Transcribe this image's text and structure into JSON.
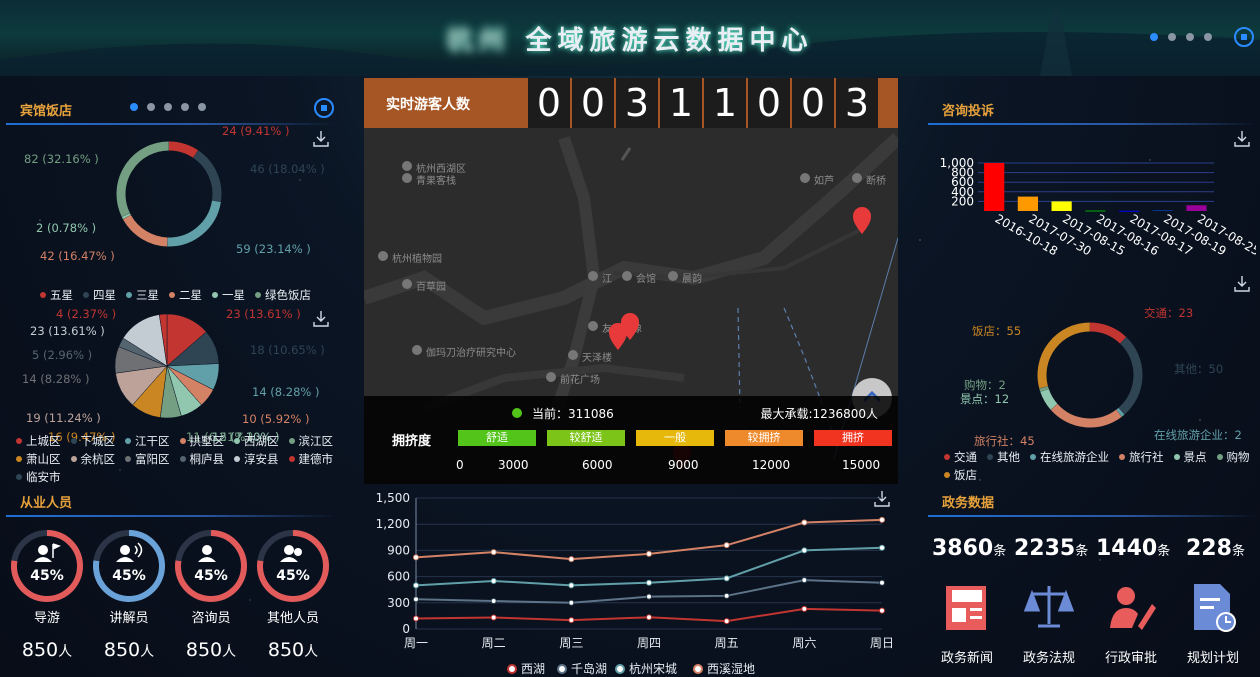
{
  "header": {
    "title_blurred": "杭州",
    "title": "全域旅游云数据中心",
    "dots": 4,
    "active_dot": 0
  },
  "hotel": {
    "title": "宾馆饭店",
    "star_ring": [
      {
        "label": "24 (9.41% )",
        "value": 24,
        "color": "#c23531"
      },
      {
        "label": "46 (18.04% )",
        "value": 46,
        "color": "#2f4554"
      },
      {
        "label": "59 (23.14% )",
        "value": 59,
        "color": "#61a0a8"
      },
      {
        "label": "42 (16.47% )",
        "value": 42,
        "color": "#d48265"
      },
      {
        "label": "2 (0.78% )",
        "value": 2,
        "color": "#91c7ae"
      },
      {
        "label": "82 (32.16% )",
        "value": 82,
        "color": "#749f83"
      }
    ],
    "star_legend": [
      {
        "name": "五星",
        "color": "#c23531"
      },
      {
        "name": "四星",
        "color": "#2f4554"
      },
      {
        "name": "三星",
        "color": "#61a0a8"
      },
      {
        "name": "二星",
        "color": "#d48265"
      },
      {
        "name": "一星",
        "color": "#91c7ae"
      },
      {
        "name": "绿色饭店",
        "color": "#749f83"
      }
    ],
    "district_pie": [
      {
        "label": "23 (13.61% )",
        "value": 23,
        "color": "#c23531"
      },
      {
        "label": "18 (10.65% )",
        "value": 18,
        "color": "#2f4554"
      },
      {
        "label": "14 (8.28% )",
        "value": 14,
        "color": "#61a0a8"
      },
      {
        "label": "10 (5.92% )",
        "value": 10,
        "color": "#d48265"
      },
      {
        "label": "12 (7.10% )",
        "value": 12,
        "color": "#91c7ae"
      },
      {
        "label": "11 (6.51% )",
        "value": 11,
        "color": "#749f83"
      },
      {
        "label": "16 (9.47% )",
        "value": 16,
        "color": "#ca8622"
      },
      {
        "label": "19 (11.24% )",
        "value": 19,
        "color": "#bda29a"
      },
      {
        "label": "14 (8.28% )",
        "value": 14,
        "color": "#6e7074"
      },
      {
        "label": "5 (2.96% )",
        "value": 5,
        "color": "#546570"
      },
      {
        "label": "23 (13.61% )",
        "value": 23,
        "color": "#c4ccd3"
      },
      {
        "label": "4 (2.37% )",
        "value": 4,
        "color": "#c23531"
      }
    ],
    "district_legend": [
      {
        "name": "上城区",
        "color": "#c23531"
      },
      {
        "name": "下城区",
        "color": "#2f4554"
      },
      {
        "name": "江干区",
        "color": "#61a0a8"
      },
      {
        "name": "拱墅区",
        "color": "#d48265"
      },
      {
        "name": "西湖区",
        "color": "#91c7ae"
      },
      {
        "name": "滨江区",
        "color": "#749f83"
      },
      {
        "name": "萧山区",
        "color": "#ca8622"
      },
      {
        "name": "余杭区",
        "color": "#bda29a"
      },
      {
        "name": "富阳区",
        "color": "#6e7074"
      },
      {
        "name": "桐庐县",
        "color": "#546570"
      },
      {
        "name": "淳安县",
        "color": "#c4ccd3"
      },
      {
        "name": "建德市",
        "color": "#c23531"
      },
      {
        "name": "临安市",
        "color": "#2f4554"
      }
    ]
  },
  "visitors": {
    "label": "实时游客人数",
    "digits": [
      "0",
      "0",
      "3",
      "1",
      "1",
      "0",
      "0",
      "3"
    ],
    "current": "当前：311086",
    "max": "最大承载:1236800人",
    "crowd_label": "拥挤度",
    "levels": [
      {
        "name": "舒适",
        "color": "#52c41a"
      },
      {
        "name": "较舒适",
        "color": "#7cc417"
      },
      {
        "name": "一般",
        "color": "#e5b80b"
      },
      {
        "name": "较拥挤",
        "color": "#ef8a2c"
      },
      {
        "name": "拥挤",
        "color": "#f0341f"
      }
    ],
    "scale": [
      "0",
      "3000",
      "6000",
      "9000",
      "12000",
      "15000"
    ],
    "map_places": [
      "杭州西湖区",
      "青果客栈",
      "杭州植物园",
      "百草园",
      "伽玛刀治疗研究中心",
      "友爱之像",
      "天泽楼",
      "前花广场",
      "会馆",
      "晨韵",
      "如芦",
      "断桥",
      "江"
    ]
  },
  "consult": {
    "title": "咨询投诉",
    "chart_data": {
      "type": "bar",
      "categories": [
        "2016-10-18",
        "2017-07-30",
        "2017-08-15",
        "2017-08-16",
        "2017-08-17",
        "2017-08-19",
        "2017-08-25"
      ],
      "values": [
        1000,
        300,
        200,
        10,
        5,
        20,
        120
      ],
      "colors": [
        "#ff0000",
        "#ff9900",
        "#ffff00",
        "#00aa00",
        "#0000ff",
        "#003399",
        "#990099"
      ],
      "yticks": [
        "1,000",
        "800",
        "600",
        "400",
        "200"
      ],
      "ylim": [
        0,
        1000
      ]
    },
    "ring": [
      {
        "name": "交通",
        "value": 23,
        "color": "#c23531",
        "label": "交通：23"
      },
      {
        "name": "其他",
        "value": 50,
        "color": "#2f4554",
        "label": "其他：50"
      },
      {
        "name": "在线旅游企业",
        "value": 2,
        "color": "#61a0a8",
        "label": "在线旅游企业：2"
      },
      {
        "name": "旅行社",
        "value": 45,
        "color": "#d48265",
        "label": "旅行社：45"
      },
      {
        "name": "景点",
        "value": 12,
        "color": "#91c7ae",
        "label": "景点：12"
      },
      {
        "name": "购物",
        "value": 2,
        "color": "#749f83",
        "label": "购物：2"
      },
      {
        "name": "饭店",
        "value": 55,
        "color": "#ca8622",
        "label": "饭店：55"
      }
    ]
  },
  "staff": {
    "title": "从业人员",
    "items": [
      {
        "name": "导游",
        "pct": "45%",
        "count": "850",
        "unit": "人",
        "color": "#e35a5a",
        "icon": "guide-flag-icon"
      },
      {
        "name": "讲解员",
        "pct": "45%",
        "count": "850",
        "unit": "人",
        "color": "#6aa3d9",
        "icon": "speaker-icon"
      },
      {
        "name": "咨询员",
        "pct": "45%",
        "count": "850",
        "unit": "人",
        "color": "#e35a5a",
        "icon": "agent-icon"
      },
      {
        "name": "其他人员",
        "pct": "45%",
        "count": "850",
        "unit": "人",
        "color": "#e35a5a",
        "icon": "people-icon"
      }
    ]
  },
  "trend": {
    "chart_data": {
      "type": "line",
      "categories": [
        "周一",
        "周二",
        "周三",
        "周四",
        "周五",
        "周六",
        "周日"
      ],
      "yticks": [
        "1,500",
        "1,200",
        "900",
        "600",
        "300",
        "0"
      ],
      "ylim": [
        0,
        1500
      ],
      "series": [
        {
          "name": "西湖",
          "color": "#c23531",
          "values": [
            120,
            132,
            101,
            134,
            90,
            230,
            210
          ]
        },
        {
          "name": "千岛湖",
          "color": "#2f4554",
          "values": [
            340,
            320,
            300,
            370,
            380,
            560,
            530
          ]
        },
        {
          "name": "杭州宋城",
          "color": "#61a0a8",
          "values": [
            500,
            550,
            500,
            530,
            580,
            900,
            930
          ]
        },
        {
          "name": "西溪湿地",
          "color": "#d48265",
          "values": [
            820,
            880,
            800,
            860,
            960,
            1220,
            1250
          ]
        }
      ]
    }
  },
  "gov": {
    "title": "政务数据",
    "items": [
      {
        "num": "3860",
        "unit": "条",
        "label": "政务新闻",
        "color": "#e85c5c",
        "icon": "news-icon"
      },
      {
        "num": "2235",
        "unit": "条",
        "label": "政务法规",
        "color": "#6b8bd6",
        "icon": "scale-icon"
      },
      {
        "num": "1440",
        "unit": "条",
        "label": "行政审批",
        "color": "#e85c5c",
        "icon": "approval-icon"
      },
      {
        "num": "228",
        "unit": "条",
        "label": "规划计划",
        "color": "#6b8bd6",
        "icon": "plan-icon"
      }
    ]
  }
}
